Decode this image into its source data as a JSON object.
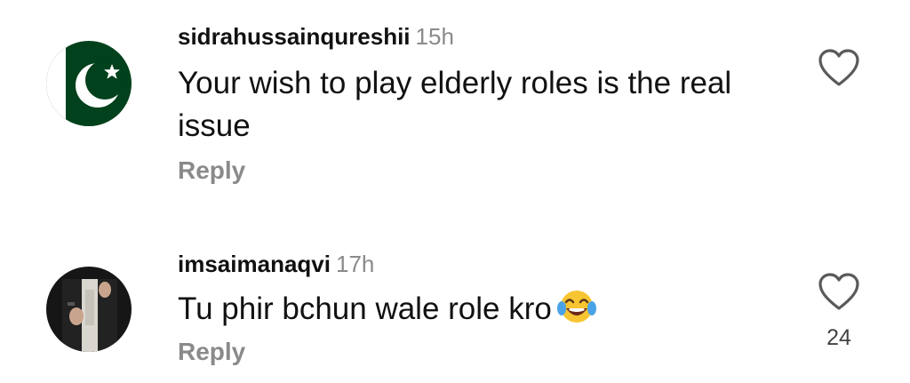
{
  "comments": [
    {
      "username": "sidrahussainqureshii",
      "time": "15h",
      "text": "Your wish to play elderly roles is the real issue",
      "reply_label": "Reply",
      "avatar_icon": "pakistan-flag-avatar",
      "like_icon": "heart-outline-icon",
      "like_count": ""
    },
    {
      "username": "imsaimanaqvi",
      "time": "17h",
      "text": "Tu phir bchun wale role kro",
      "emoji_icon": "face-with-tears-of-joy-emoji",
      "reply_label": "Reply",
      "avatar_icon": "profile-photo-avatar",
      "like_icon": "heart-outline-icon",
      "like_count": "24"
    }
  ],
  "colors": {
    "flag_green": "#01411c",
    "secondary_text": "#8a8a8a",
    "primary_text": "#111111"
  }
}
